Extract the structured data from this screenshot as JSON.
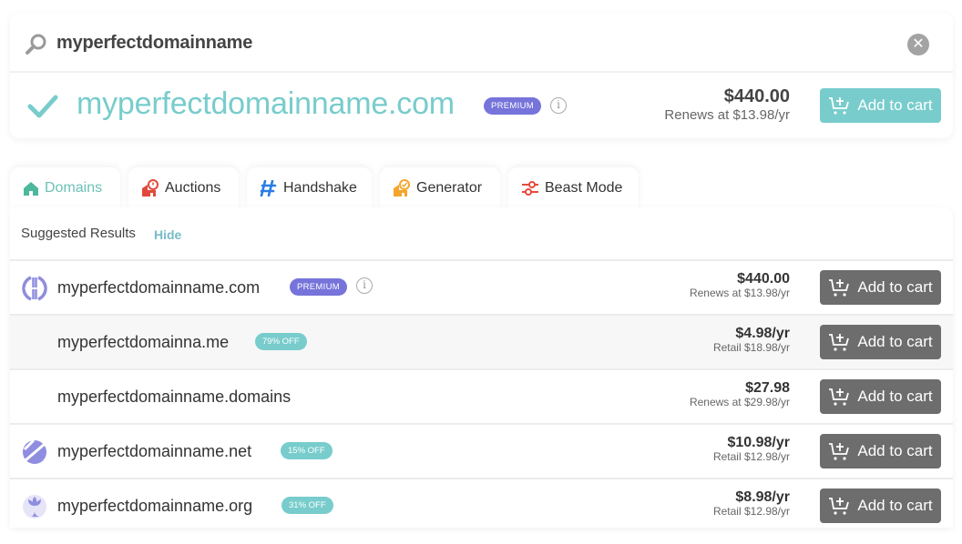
{
  "search": {
    "query": "myperfectdomainname",
    "clear_icon": "close-circle-icon"
  },
  "exact_match": {
    "domain": "myperfectdomainname.com",
    "status_icon": "checkmark-icon",
    "badge": "PREMIUM",
    "price": "$440.00",
    "renewal": "Renews at $13.98/yr",
    "cart_label": "Add to cart"
  },
  "tabs": [
    {
      "label": "Domains",
      "icon": "home-icon",
      "active": true
    },
    {
      "label": "Auctions",
      "icon": "auction-icon",
      "active": false
    },
    {
      "label": "Handshake",
      "icon": "handshake-icon",
      "active": false
    },
    {
      "label": "Generator",
      "icon": "generator-icon",
      "active": false
    },
    {
      "label": "Beast Mode",
      "icon": "sliders-icon",
      "active": false
    }
  ],
  "suggested": {
    "heading": "Suggested Results",
    "hide_label": "Hide",
    "rows": [
      {
        "domain": "myperfectdomainname.com",
        "icon": "globe-icon",
        "badge": "PREMIUM",
        "badge_type": "premium",
        "info": true,
        "price": "$440.00",
        "sub": "Renews at $13.98/yr",
        "cart_label": "Add to cart"
      },
      {
        "domain": "myperfectdomainna.me",
        "icon": "",
        "badge": "79% OFF",
        "badge_type": "off",
        "info": false,
        "price": "$4.98/yr",
        "sub": "Retail $18.98/yr",
        "cart_label": "Add to cart"
      },
      {
        "domain": "myperfectdomainname.domains",
        "icon": "",
        "badge": "",
        "badge_type": "",
        "info": false,
        "price": "$27.98",
        "sub": "Renews at $29.98/yr",
        "cart_label": "Add to cart"
      },
      {
        "domain": "myperfectdomainname.net",
        "icon": "net-icon",
        "badge": "15% OFF",
        "badge_type": "off",
        "info": false,
        "price": "$10.98/yr",
        "sub": "Retail $12.98/yr",
        "cart_label": "Add to cart"
      },
      {
        "domain": "myperfectdomainname.org",
        "icon": "org-icon",
        "badge": "31% OFF",
        "badge_type": "off",
        "info": false,
        "price": "$8.98/yr",
        "sub": "Retail $12.98/yr",
        "cart_label": "Add to cart"
      }
    ]
  },
  "colors": {
    "accent_teal": "#78cccc",
    "premium_purple": "#7674da",
    "cart_dark": "#6d6d6d"
  }
}
